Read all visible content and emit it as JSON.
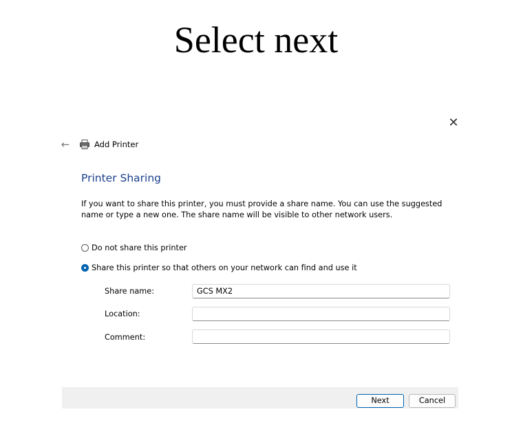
{
  "caption": "Select next",
  "window": {
    "title": "Add Printer",
    "back_icon": "back-arrow-icon",
    "printer_icon": "printer-icon",
    "close_icon": "close-icon"
  },
  "section": {
    "title": "Printer Sharing",
    "description": "If you want to share this printer, you must provide a share name. You can use the suggested name or type a new one. The share name will be visible to other network users."
  },
  "options": {
    "do_not_share": {
      "label": "Do not share this printer",
      "selected": false
    },
    "share": {
      "label": "Share this printer so that others on your network can find and use it",
      "selected": true
    }
  },
  "fields": {
    "share_name": {
      "label": "Share name:",
      "value": "GCS MX2"
    },
    "location": {
      "label": "Location:",
      "value": ""
    },
    "comment": {
      "label": "Comment:",
      "value": ""
    }
  },
  "buttons": {
    "next": "Next",
    "cancel": "Cancel"
  },
  "colors": {
    "accent": "#0063b1",
    "heading": "#193f8c",
    "footer_bg": "#f0f0f0"
  }
}
